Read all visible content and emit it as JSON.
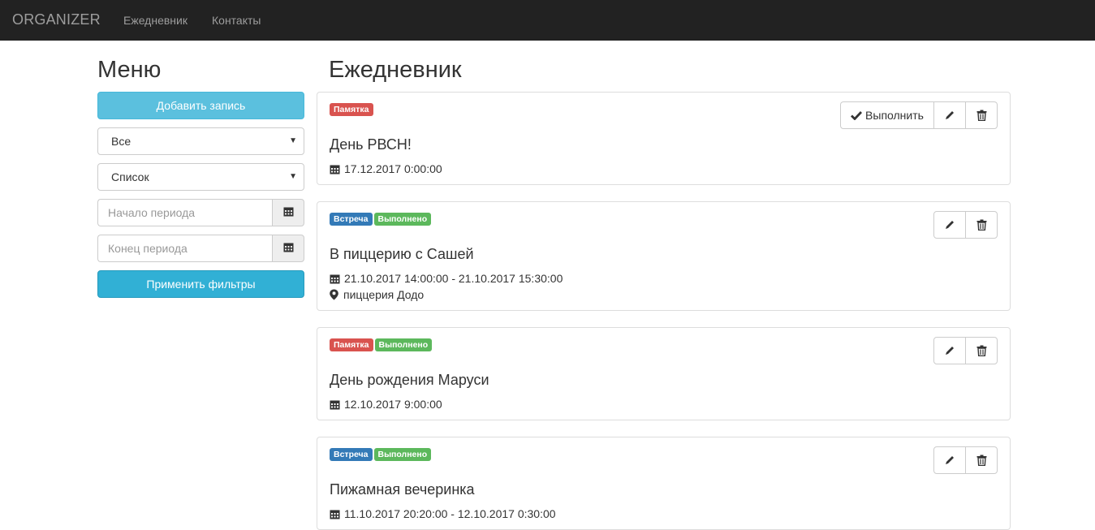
{
  "navbar": {
    "brand": "ORGANIZER",
    "links": [
      "Ежедневник",
      "Контакты"
    ]
  },
  "sidebar": {
    "title": "Меню",
    "add_button": "Добавить запись",
    "filter_type": "Все",
    "view_mode": "Список",
    "period_start_placeholder": "Начало периода",
    "period_end_placeholder": "Конец периода",
    "apply_button": "Применить фильтры"
  },
  "main": {
    "title": "Ежедневник",
    "complete_button": "Выполнить",
    "entries": [
      {
        "badges": [
          {
            "text": "Памятка",
            "color": "#d9534f"
          }
        ],
        "title": "День РВСН!",
        "datetime": "17.12.2017 0:00:00"
      },
      {
        "badges": [
          {
            "text": "Встреча",
            "color": "#337ab7"
          },
          {
            "text": "Выполнено",
            "color": "#5cb85c"
          }
        ],
        "title": "В пиццерию с Сашей",
        "datetime": "21.10.2017 14:00:00 - 21.10.2017 15:30:00",
        "location": "пиццерия Додо"
      },
      {
        "badges": [
          {
            "text": "Памятка",
            "color": "#d9534f"
          },
          {
            "text": "Выполнено",
            "color": "#5cb85c"
          }
        ],
        "title": "День рождения Маруси",
        "datetime": "12.10.2017 9:00:00"
      },
      {
        "badges": [
          {
            "text": "Встреча",
            "color": "#337ab7"
          },
          {
            "text": "Выполнено",
            "color": "#5cb85c"
          }
        ],
        "title": "Пижамная вечеринка",
        "datetime": "11.10.2017 20:20:00 - 12.10.2017 0:30:00"
      }
    ]
  }
}
